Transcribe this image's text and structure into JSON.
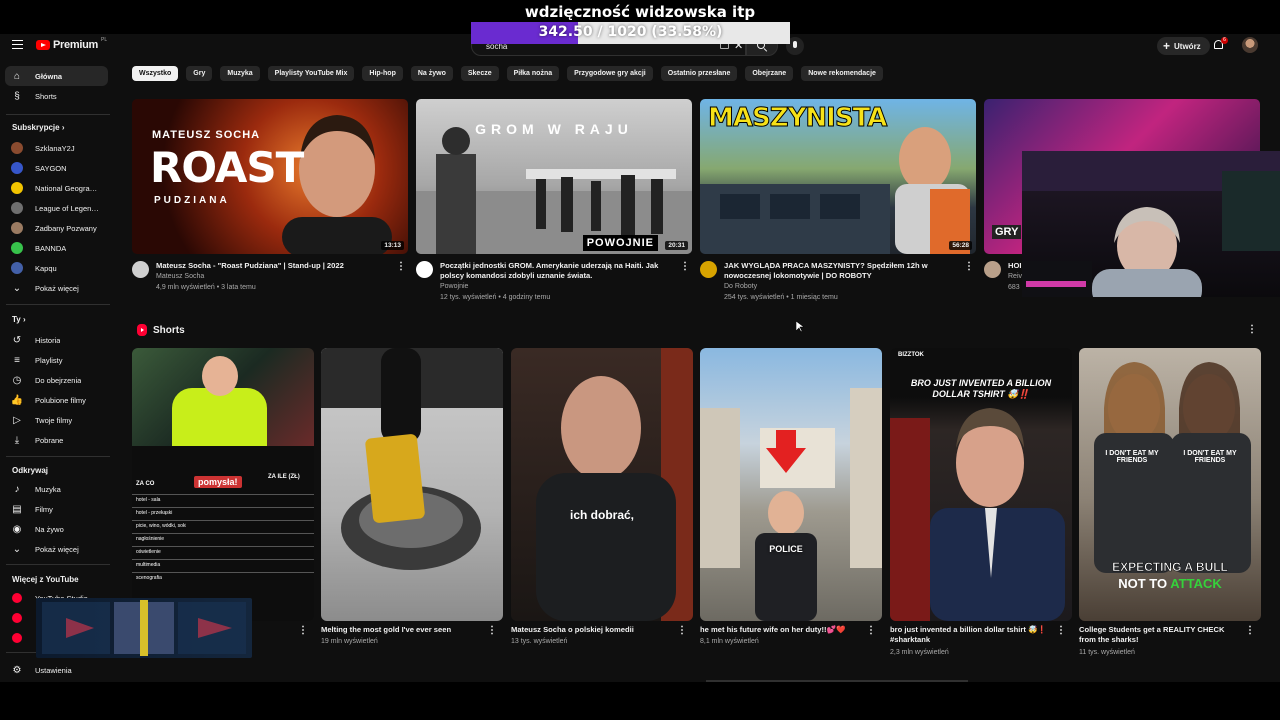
{
  "overlay": {
    "title": "wdzięczność widzowska itp",
    "goal_text": "342.50 / 1020 (33.58%)",
    "goal_fraction": 0.3358,
    "goal_color": "#6a2bd0"
  },
  "topbar": {
    "logo_text": "Premium",
    "logo_region": "PL",
    "search_value": "socha",
    "create_label": "Utwórz",
    "notification_count": "6"
  },
  "sidebar": {
    "main": [
      {
        "label": "Główna",
        "icon": "home-icon",
        "glyph": "⌂"
      },
      {
        "label": "Shorts",
        "icon": "shorts-icon",
        "glyph": "§"
      }
    ],
    "subscriptions_heading": "Subskrypcje",
    "subscriptions": [
      {
        "label": "SzklanaY2J",
        "color": "#8a4b2f"
      },
      {
        "label": "SAYGON",
        "color": "#3656c9"
      },
      {
        "label": "National Geogra…",
        "color": "#f2c400"
      },
      {
        "label": "League of Legen…",
        "color": "#6f6f6f"
      },
      {
        "label": "Zadbany Pozwany",
        "color": "#9b7b62"
      },
      {
        "label": "BANNDA",
        "color": "#37c24b"
      },
      {
        "label": "Kapqu",
        "color": "#4360a8"
      }
    ],
    "show_more": "Pokaż więcej",
    "you_heading": "Ty",
    "you_items": [
      {
        "label": "Historia",
        "glyph": "↺"
      },
      {
        "label": "Playlisty",
        "glyph": "≡"
      },
      {
        "label": "Do obejrzenia",
        "glyph": "◷"
      },
      {
        "label": "Polubione filmy",
        "glyph": "👍"
      },
      {
        "label": "Twoje filmy",
        "glyph": "▷"
      },
      {
        "label": "Pobrane",
        "glyph": "⤓"
      }
    ],
    "explore_heading": "Odkrywaj",
    "explore_items": [
      {
        "label": "Muzyka",
        "glyph": "♪"
      },
      {
        "label": "Filmy",
        "glyph": "▤"
      },
      {
        "label": "Na żywo",
        "glyph": "◉"
      }
    ],
    "explore_more": "Pokaż więcej",
    "more_heading": "Więcej z YouTube",
    "more_items": [
      {
        "label": "YouTube Studio"
      }
    ],
    "settings": "Ustawienia"
  },
  "chips": [
    "Wszystko",
    "Gry",
    "Muzyka",
    "Playlisty YouTube Mix",
    "Hip-hop",
    "Na żywo",
    "Skecze",
    "Piłka nożna",
    "Przygodowe gry akcji",
    "Ostatnio przesłane",
    "Obejrzane",
    "Nowe rekomendacje"
  ],
  "videos": [
    {
      "title": "Mateusz Socha - \"Roast Pudziana\" | Stand-up | 2022",
      "channel": "Mateusz Socha",
      "stats": "4,9 mln wyświetleń • 3 lata temu",
      "duration": "13:13",
      "thumb_line1": "MATEUSZ SOCHA",
      "thumb_line2": "ROAST",
      "thumb_line3": "PUDZIANA"
    },
    {
      "title": "Początki jednostki GROM. Amerykanie uderzają na Haiti. Jak polscy komandosi zdobyli uznanie świata.",
      "channel": "Powojnie",
      "stats": "12 tys. wyświetleń • 4 godziny temu",
      "duration": "20:31",
      "thumb_line1": "GROM W RAJU",
      "thumb_line2": "POWOJNIE"
    },
    {
      "title": "JAK WYGLĄDA PRACA MASZYNISTY? Spędziłem 12h w nowoczesnej lokomotywie | DO ROBOTY",
      "channel": "Do Roboty",
      "stats": "254 tys. wyświetleń • 1 miesiąc temu",
      "duration": "56:28",
      "thumb_line1": "MASZYNISTA"
    },
    {
      "title": "HOI",
      "channel": "Reiv",
      "stats": "683",
      "thumb_line1": "GRY"
    }
  ],
  "shorts_heading": "Shorts",
  "shorts": [
    {
      "title": "",
      "views": "",
      "thumb_text": "pomysła!",
      "table_headers": [
        "ZA CO",
        "ZA ILE (ZŁ)"
      ],
      "table_rows": [
        "hotel - sala",
        "hotel - przekąski",
        "picie, wino, wódki, soki, drinki z baru",
        "nagłośnienie",
        "oświetlenie",
        "multimedia",
        "scenografia"
      ]
    },
    {
      "title": "Melting the most gold I've ever seen",
      "views": "19 mln wyświetleń"
    },
    {
      "title": "Mateusz Socha o polskiej komedii",
      "views": "13 tys. wyświetleń",
      "caption": "ich dobrać,"
    },
    {
      "title": "he met his future wife on her duty!!💕❤️",
      "views": "8,1 mln wyświetleń",
      "thumb_text": "POLICE"
    },
    {
      "title": "bro just invented a billion dollar tshirt 🤯❗ #sharktank",
      "views": "2,3 mln wyświetleń",
      "thumb_channel": "BIZZTOK",
      "thumb_text": "BRO JUST INVENTED A BILLION DOLLAR TSHIRT 🤯‼️"
    },
    {
      "title": "College Students get a REALITY CHECK from the sharks!",
      "views": "11 tys. wyświetleń",
      "thumb_text_1": "EXPECTING A BULL",
      "thumb_text_2": "NOT TO",
      "thumb_text_3": "ATTACK",
      "shirt_text": "I DON'T EAT MY FRIENDS"
    }
  ]
}
